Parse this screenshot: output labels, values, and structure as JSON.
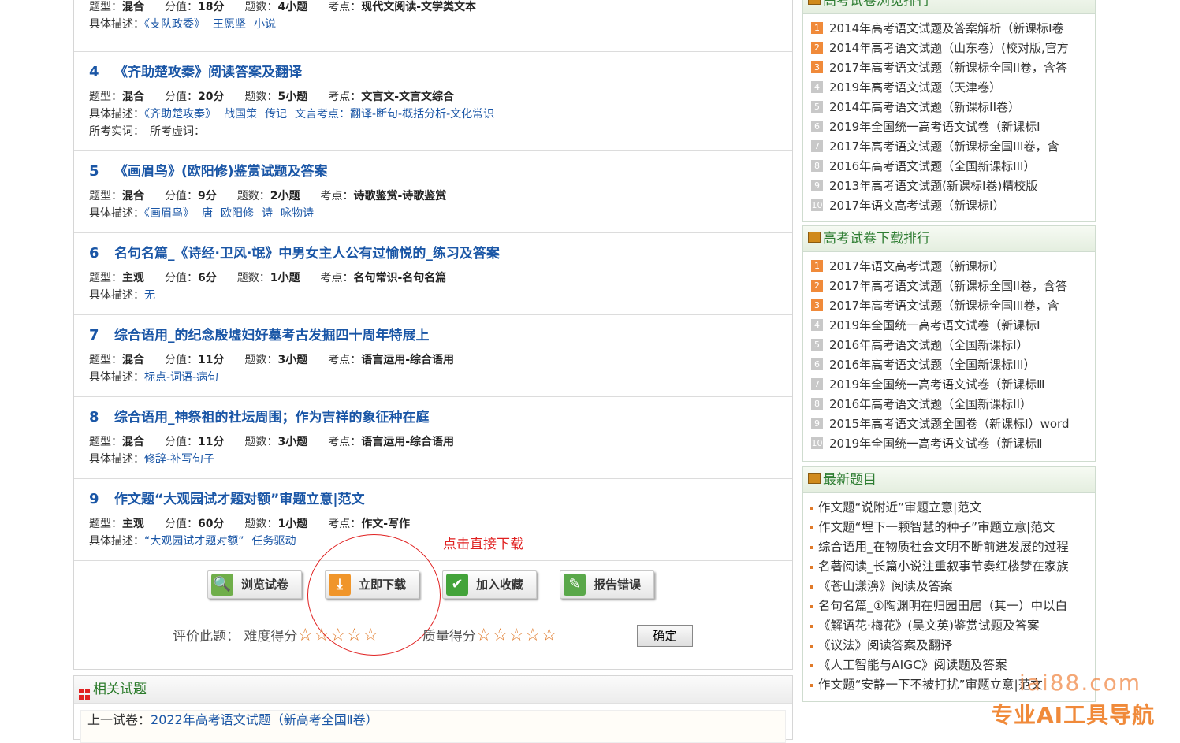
{
  "questions": [
    {
      "type_k": "题型：",
      "type_v": "混合",
      "score_k": "分值：",
      "score_v": "18分",
      "count_k": "题数：",
      "count_v": "4小题",
      "point_k": "考点：",
      "point_v": "现代文阅读-文学类文本",
      "desc_k": "具体描述：",
      "desc_tags": [
        "《支队政委》",
        "王愿坚",
        "小说"
      ]
    },
    {
      "num": "4",
      "title": "《齐助楚攻秦》阅读答案及翻译",
      "type_k": "题型：",
      "type_v": "混合",
      "score_k": "分值：",
      "score_v": "20分",
      "count_k": "题数：",
      "count_v": "5小题",
      "point_k": "考点：",
      "point_v": "文言文-文言文综合",
      "desc_k": "具体描述：",
      "desc_tags": [
        "《齐助楚攻秦》",
        "战国策",
        "传记",
        "文言考点：翻译-断句-概括分析-文化常识"
      ],
      "extra": "所考实词：　所考虚词："
    },
    {
      "num": "5",
      "title": "《画眉鸟》(欧阳修)鉴赏试题及答案",
      "type_k": "题型：",
      "type_v": "混合",
      "score_k": "分值：",
      "score_v": "9分",
      "count_k": "题数：",
      "count_v": "2小题",
      "point_k": "考点：",
      "point_v": "诗歌鉴赏-诗歌鉴赏",
      "desc_k": "具体描述：",
      "desc_tags": [
        "《画眉鸟》",
        "唐",
        "欧阳修",
        "诗",
        "咏物诗"
      ]
    },
    {
      "num": "6",
      "title": "名句名篇_《诗经·卫风·氓》中男女主人公有过愉悦的_练习及答案",
      "type_k": "题型：",
      "type_v": "主观",
      "score_k": "分值：",
      "score_v": "6分",
      "count_k": "题数：",
      "count_v": "1小题",
      "point_k": "考点：",
      "point_v": "名句常识-名句名篇",
      "desc_k": "具体描述：",
      "desc_tags": [
        "无"
      ]
    },
    {
      "num": "7",
      "title": "综合语用_的纪念殷墟妇好墓考古发掘四十周年特展上",
      "type_k": "题型：",
      "type_v": "混合",
      "score_k": "分值：",
      "score_v": "11分",
      "count_k": "题数：",
      "count_v": "3小题",
      "point_k": "考点：",
      "point_v": "语言运用-综合语用",
      "desc_k": "具体描述：",
      "desc_tags": [
        "标点-词语-病句"
      ]
    },
    {
      "num": "8",
      "title": "综合语用_神祭祖的社坛周围；作为吉祥的象征种在庭",
      "type_k": "题型：",
      "type_v": "混合",
      "score_k": "分值：",
      "score_v": "11分",
      "count_k": "题数：",
      "count_v": "3小题",
      "point_k": "考点：",
      "point_v": "语言运用-综合语用",
      "desc_k": "具体描述：",
      "desc_tags": [
        "修辞-补写句子"
      ]
    },
    {
      "num": "9",
      "title": "作文题“大观园试才题对额”审题立意|范文",
      "type_k": "题型：",
      "type_v": "主观",
      "score_k": "分值：",
      "score_v": "60分",
      "count_k": "题数：",
      "count_v": "1小题",
      "point_k": "考点：",
      "point_v": "作文-写作",
      "desc_k": "具体描述：",
      "desc_tags": [
        "“大观园试才题对额”",
        "任务驱动"
      ]
    }
  ],
  "buttons": {
    "browse": "浏览试卷",
    "download": "立即下载",
    "favorite": "加入收藏",
    "report": "报告错误"
  },
  "annotation": "点击直接下载",
  "rating": {
    "label": "评价此题：",
    "difficulty": "难度得分",
    "quality": "质量得分",
    "stars": "☆☆☆☆☆",
    "ok": "确定"
  },
  "related": {
    "title": "相关试题",
    "prev_label": "上一试卷：",
    "prev_link": "2022年高考语文试题（新高考全国Ⅱ卷）"
  },
  "browse_rank": {
    "title": "高考试卷浏览排行",
    "items": [
      "2014年高考语文试题及答案解析（新课标Ⅰ卷",
      "2014年高考语文试题（山东卷）(校对版,官方",
      "2017年高考语文试题（新课标全国II卷，含答",
      "2019年高考语文试题（天津卷）",
      "2014年高考语文试题（新课标II卷）",
      "2019年全国统一高考语文试卷（新课标Ⅰ",
      "2017年高考语文试题（新课标全国III卷，含",
      "2016年高考语文试题（全国新课标III）",
      "2013年高考语文试题(新课标I卷)精校版",
      "2017年语文高考试题（新课标Ⅰ）"
    ]
  },
  "download_rank": {
    "title": "高考试卷下载排行",
    "items": [
      "2017年语文高考试题（新课标Ⅰ）",
      "2017年高考语文试题（新课标全国II卷，含答",
      "2017年高考语文试题（新课标全国III卷，含",
      "2019年全国统一高考语文试卷（新课标Ⅰ",
      "2016年高考语文试题（全国新课标I）",
      "2016年高考语文试题（全国新课标III）",
      "2019年全国统一高考语文试卷（新课标Ⅲ",
      "2016年高考语文试题（全国新课标II）",
      "2015年高考语文试题全国卷（新课标I）word",
      "2019年全国统一高考语文试卷（新课标Ⅱ"
    ]
  },
  "latest": {
    "title": "最新题目",
    "items": [
      "作文题“说附近”审题立意|范文",
      "作文题“埋下一颗智慧的种子”审题立意|范文",
      "综合语用_在物质社会文明不断前进发展的过程",
      "名著阅读_长篇小说注重叙事节奏红楼梦在家族",
      "《苍山漾濞》阅读及答案",
      "名句名篇_①陶渊明在归园田居（其一）中以白",
      "《解语花·梅花》(吴文英)鉴赏试题及答案",
      "《议法》阅读答案及翻译",
      "《人工智能与AIGC》阅读题及答案",
      "作文题“安静一下不被打扰”审题立意|范文"
    ]
  },
  "watermark": {
    "domain": "iai88.com",
    "slogan": "专业AI工具导航"
  }
}
